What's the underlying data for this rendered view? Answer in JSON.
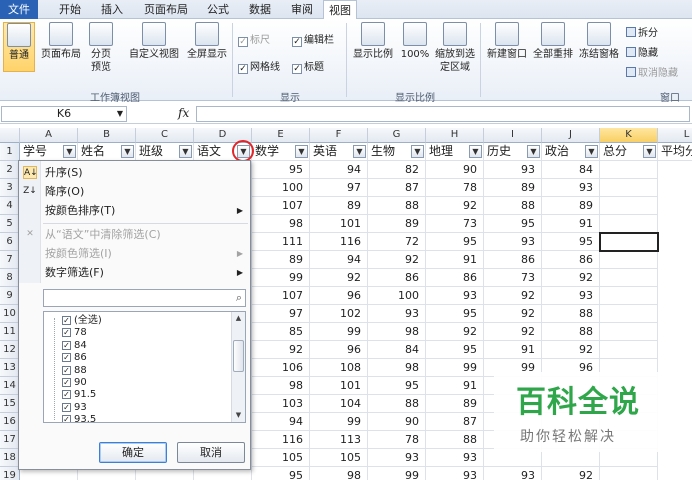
{
  "menu": {
    "tabs": [
      "文件",
      "开始",
      "插入",
      "页面布局",
      "公式",
      "数据",
      "审阅",
      "视图"
    ]
  },
  "ribbon": {
    "workbook_views": {
      "label": "工作簿视图",
      "buttons": [
        "普通",
        "页面布局",
        "分页预览",
        "自定义视图",
        "全屏显示"
      ]
    },
    "show": {
      "label": "显示",
      "checks": [
        {
          "text": "标尺",
          "checked": true,
          "disabled": true
        },
        {
          "text": "编辑栏",
          "checked": true,
          "disabled": false
        },
        {
          "text": "网格线",
          "checked": true,
          "disabled": false
        },
        {
          "text": "标题",
          "checked": true,
          "disabled": false
        }
      ]
    },
    "zoom": {
      "label": "显示比例",
      "buttons": [
        "显示比例",
        "100%",
        "缩放到选定区域"
      ]
    },
    "window": {
      "label": "窗口",
      "buttons": [
        "新建窗口",
        "全部重排",
        "冻结窗格"
      ],
      "small": [
        {
          "text": "拆分",
          "disabled": false
        },
        {
          "text": "隐藏",
          "disabled": false
        },
        {
          "text": "取消隐藏",
          "disabled": true
        }
      ]
    }
  },
  "formula_bar": {
    "name_box": "K6",
    "fx": "fx"
  },
  "sheet": {
    "columns": [
      "A",
      "B",
      "C",
      "D",
      "E",
      "F",
      "G",
      "H",
      "I",
      "J",
      "K",
      "L"
    ],
    "selected_column": "K",
    "rows": [
      "1",
      "2",
      "3",
      "4",
      "5",
      "6",
      "7",
      "8",
      "9",
      "10",
      "11",
      "12",
      "13",
      "14",
      "15",
      "16",
      "17",
      "18",
      "19"
    ],
    "headers": [
      "学号",
      "姓名",
      "班级",
      "语文",
      "数学",
      "英语",
      "生物",
      "地理",
      "历史",
      "政治",
      "总分",
      "平均分"
    ],
    "data": [
      [
        "95",
        "94",
        "82",
        "90",
        "93",
        "84"
      ],
      [
        "100",
        "97",
        "87",
        "78",
        "89",
        "93"
      ],
      [
        "107",
        "89",
        "88",
        "92",
        "88",
        "89"
      ],
      [
        "98",
        "101",
        "89",
        "73",
        "95",
        "91"
      ],
      [
        "111",
        "116",
        "72",
        "95",
        "93",
        "95"
      ],
      [
        "89",
        "94",
        "92",
        "91",
        "86",
        "86"
      ],
      [
        "99",
        "92",
        "86",
        "86",
        "73",
        "92"
      ],
      [
        "107",
        "96",
        "100",
        "93",
        "92",
        "93"
      ],
      [
        "97",
        "102",
        "93",
        "95",
        "92",
        "88"
      ],
      [
        "85",
        "99",
        "98",
        "92",
        "92",
        "88"
      ],
      [
        "92",
        "96",
        "84",
        "95",
        "91",
        "92"
      ],
      [
        "106",
        "108",
        "98",
        "99",
        "99",
        "96"
      ],
      [
        "98",
        "101",
        "95",
        "91",
        "",
        ""
      ],
      [
        "103",
        "104",
        "88",
        "89",
        "",
        ""
      ],
      [
        "94",
        "99",
        "90",
        "87",
        "",
        ""
      ],
      [
        "116",
        "113",
        "78",
        "88",
        "",
        ""
      ],
      [
        "105",
        "105",
        "93",
        "93",
        "",
        ""
      ],
      [
        "95",
        "98",
        "99",
        "93",
        "93",
        "92"
      ]
    ]
  },
  "filter_menu": {
    "sort_asc": "升序(S)",
    "sort_desc": "降序(O)",
    "sort_by_color": "按颜色排序(T)",
    "clear_filter": "从“语文”中清除筛选(C)",
    "filter_by_color": "按颜色筛选(I)",
    "number_filters": "数字筛选(F)",
    "search_placeholder": "",
    "items": [
      "(全选)",
      "78",
      "84",
      "86",
      "88",
      "90",
      "91.5",
      "93",
      "93.5"
    ],
    "ok": "确定",
    "cancel": "取消"
  },
  "watermark": {
    "main": "百科全说",
    "sub": "助你轻松解决"
  }
}
